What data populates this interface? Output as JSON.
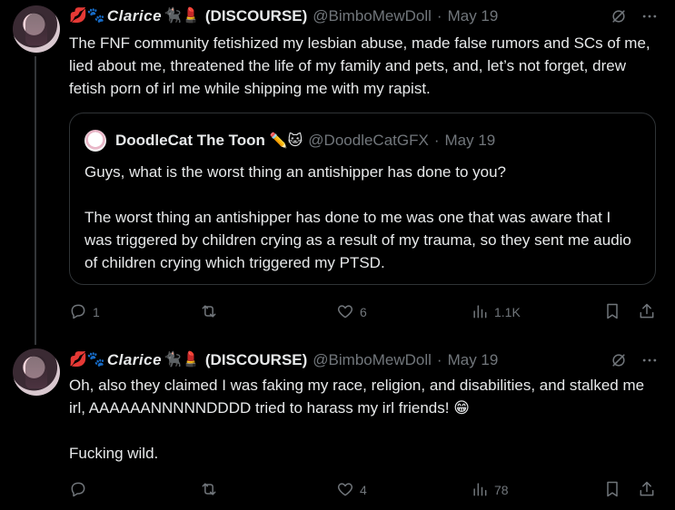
{
  "tweets": [
    {
      "emoji_prefix": "💋🐾",
      "name_styled": "Clarice",
      "emoji_suffix": "🐈‍⬛💄",
      "name_tag": "(DISCOURSE)",
      "handle": "@BimboMewDoll",
      "dot": "·",
      "date": "May 19",
      "text": "The FNF community fetishized my lesbian abuse, made false rumors and SCs of me, lied about me, threatened the life of my family and pets, and, let’s not forget, drew fetish porn of irl me while shipping me with my rapist.",
      "quote": {
        "name": "DoodleCat The Toon",
        "name_emoji": "✏️🐱",
        "handle": "@DoodleCatGFX",
        "dot": "·",
        "date": "May 19",
        "text": "Guys, what is the worst thing an antishipper has done to you?\n\nThe worst thing an antishipper has done to me was one that was aware that I was triggered by children crying as a result of my trauma, so they sent me audio of children crying which triggered my PTSD."
      },
      "actions": {
        "replies": "1",
        "retweets": "",
        "likes": "6",
        "views": "1.1K"
      }
    },
    {
      "emoji_prefix": "💋🐾",
      "name_styled": "Clarice",
      "emoji_suffix": "🐈‍⬛💄",
      "name_tag": "(DISCOURSE)",
      "handle": "@BimboMewDoll",
      "dot": "·",
      "date": "May 19",
      "text": "Oh, also they claimed I was faking my race, religion, and disabilities, and stalked me irl, AAAAAANNNNNDDDD tried to harass my irl friends! 😁\n\nFucking wild.",
      "actions": {
        "replies": "",
        "retweets": "",
        "likes": "4",
        "views": "78"
      }
    }
  ],
  "icons": [
    "grok-slash-icon",
    "more-icon",
    "reply-icon",
    "retweet-icon",
    "like-icon",
    "views-icon",
    "bookmark-icon",
    "share-icon"
  ]
}
